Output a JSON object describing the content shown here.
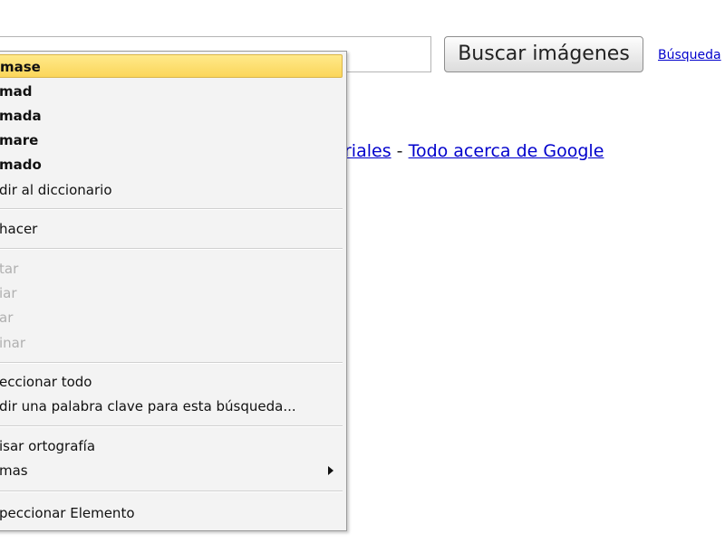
{
  "search": {
    "value": "",
    "button_label": "Buscar imágenes",
    "advanced_link": "Búsqueda"
  },
  "footer": {
    "link_partial": "riales",
    "separator": "-",
    "link_about": "Todo acerca de Google"
  },
  "context_menu": {
    "suggestions": [
      "mase",
      "mad",
      "mada",
      "mare",
      "mado"
    ],
    "add_to_dictionary": "dir al diccionario",
    "undo": "hacer",
    "cut": "tar",
    "copy": "iar",
    "paste": "ar",
    "delete": "inar",
    "select_all": "eccionar todo",
    "add_keyword": "dir una palabra clave para esta búsqueda...",
    "check_spelling": "isar ortografía",
    "languages": "mas",
    "inspect": "peccionar Elemento"
  }
}
